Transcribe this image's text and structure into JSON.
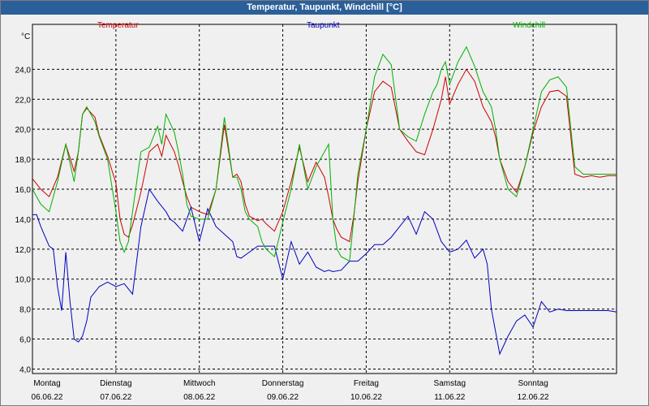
{
  "window": {
    "title": "Temperatur, Taupunkt, Windchill [°C]"
  },
  "chart_data": {
    "type": "line",
    "title": "Temperatur, Taupunkt, Windchill [°C]",
    "ylabel": "°C",
    "ylim": [
      3.7,
      27.0
    ],
    "yticks": [
      "4,0",
      "6,0",
      "8,0",
      "10,0",
      "12,0",
      "14,0",
      "16,0",
      "18,0",
      "20,0",
      "22,0",
      "24,0"
    ],
    "ytick_values": [
      4,
      6,
      8,
      10,
      12,
      14,
      16,
      18,
      20,
      22,
      24
    ],
    "xlim": [
      0,
      7
    ],
    "x_days": [
      {
        "day": "Montag",
        "date": "06.06.22"
      },
      {
        "day": "Dienstag",
        "date": "07.06.22"
      },
      {
        "day": "Mittwoch",
        "date": "08.06.22"
      },
      {
        "day": "Donnerstag",
        "date": "09.06.22"
      },
      {
        "day": "Freitag",
        "date": "10.06.22"
      },
      {
        "day": "Samstag",
        "date": "11.06.22"
      },
      {
        "day": "Sonntag",
        "date": "12.06.22"
      }
    ],
    "grid": true,
    "legend_position": "top",
    "series": [
      {
        "name": "Temperatur",
        "color": "#cc0000",
        "x": [
          0,
          0.1,
          0.2,
          0.3,
          0.4,
          0.5,
          0.55,
          0.6,
          0.65,
          0.75,
          0.8,
          0.9,
          1.0,
          1.05,
          1.1,
          1.15,
          1.2,
          1.3,
          1.4,
          1.5,
          1.55,
          1.6,
          1.7,
          1.75,
          1.8,
          1.85,
          1.9,
          2.0,
          2.1,
          2.2,
          2.3,
          2.4,
          2.45,
          2.5,
          2.55,
          2.6,
          2.7,
          2.75,
          2.8,
          2.9,
          3.0,
          3.1,
          3.2,
          3.3,
          3.4,
          3.5,
          3.55,
          3.6,
          3.65,
          3.7,
          3.8,
          3.85,
          3.9,
          4.0,
          4.1,
          4.2,
          4.3,
          4.4,
          4.5,
          4.6,
          4.7,
          4.8,
          4.85,
          4.9,
          4.95,
          5.0,
          5.1,
          5.2,
          5.3,
          5.4,
          5.45,
          5.5,
          5.55,
          5.6,
          5.7,
          5.8,
          5.9,
          6.0,
          6.1,
          6.2,
          6.3,
          6.4,
          6.5,
          6.6,
          6.7,
          6.8,
          6.9,
          6.95,
          7.0
        ],
        "values": [
          16.7,
          16.0,
          15.5,
          16.8,
          19.0,
          17.2,
          18.5,
          21.0,
          21.4,
          20.8,
          19.6,
          18.2,
          16.4,
          14.0,
          13.0,
          12.8,
          13.6,
          15.8,
          18.5,
          19.0,
          18.2,
          19.6,
          18.5,
          17.6,
          16.5,
          15.5,
          14.8,
          14.5,
          14.3,
          16.0,
          20.3,
          16.8,
          17.0,
          16.5,
          15.0,
          14.2,
          13.9,
          14.0,
          13.7,
          13.2,
          14.5,
          16.5,
          18.8,
          16.5,
          17.8,
          16.8,
          15.5,
          14.0,
          13.3,
          12.8,
          12.5,
          14.2,
          16.5,
          20.0,
          22.5,
          23.2,
          22.8,
          20.0,
          19.2,
          18.5,
          18.3,
          20.0,
          21.0,
          22.0,
          23.5,
          21.7,
          23.0,
          24.0,
          23.2,
          21.5,
          21.0,
          20.5,
          19.5,
          18.0,
          16.5,
          15.8,
          17.5,
          19.8,
          21.5,
          22.5,
          22.6,
          22.2,
          17.0,
          16.8,
          16.9,
          16.8,
          16.9,
          16.9,
          16.9
        ]
      },
      {
        "name": "Taupunkt",
        "color": "#0000c0",
        "x": [
          0,
          0.05,
          0.1,
          0.2,
          0.25,
          0.3,
          0.35,
          0.4,
          0.45,
          0.5,
          0.55,
          0.6,
          0.65,
          0.7,
          0.8,
          0.9,
          1.0,
          1.1,
          1.2,
          1.3,
          1.4,
          1.5,
          1.6,
          1.65,
          1.7,
          1.8,
          1.9,
          2.0,
          2.1,
          2.2,
          2.3,
          2.4,
          2.45,
          2.5,
          2.6,
          2.7,
          2.8,
          2.9,
          3.0,
          3.1,
          3.2,
          3.3,
          3.4,
          3.5,
          3.55,
          3.6,
          3.7,
          3.8,
          3.9,
          4.0,
          4.1,
          4.2,
          4.3,
          4.4,
          4.5,
          4.6,
          4.7,
          4.8,
          4.9,
          5.0,
          5.1,
          5.2,
          5.3,
          5.4,
          5.45,
          5.5,
          5.6,
          5.7,
          5.8,
          5.9,
          6.0,
          6.1,
          6.2,
          6.3,
          6.4,
          6.45,
          6.5,
          6.55,
          6.6,
          6.7,
          6.8,
          6.9,
          7.0
        ],
        "values": [
          14.3,
          14.3,
          13.5,
          12.2,
          12.0,
          9.5,
          7.9,
          11.8,
          8.5,
          6.0,
          5.8,
          6.2,
          7.2,
          8.8,
          9.5,
          9.8,
          9.5,
          9.7,
          9.0,
          13.5,
          16.0,
          15.2,
          14.5,
          14.0,
          13.8,
          13.2,
          14.8,
          12.5,
          14.7,
          13.5,
          13.0,
          12.5,
          11.5,
          11.4,
          11.8,
          12.2,
          12.2,
          12.2,
          10.0,
          12.5,
          11.0,
          11.8,
          10.8,
          10.5,
          10.6,
          10.5,
          10.6,
          11.2,
          11.2,
          11.7,
          12.3,
          12.3,
          12.8,
          13.5,
          14.2,
          13.0,
          14.5,
          14.0,
          12.5,
          11.8,
          12.0,
          12.6,
          11.4,
          12.0,
          11.0,
          8.0,
          5.0,
          6.2,
          7.2,
          7.6,
          6.8,
          8.5,
          7.8,
          8.0,
          7.9,
          7.9,
          7.9,
          7.9,
          7.9,
          7.9,
          7.9,
          7.9,
          7.8
        ]
      },
      {
        "name": "Windchill",
        "color": "#00b000",
        "x": [
          0,
          0.1,
          0.2,
          0.3,
          0.4,
          0.5,
          0.55,
          0.6,
          0.65,
          0.75,
          0.8,
          0.9,
          1.0,
          1.05,
          1.1,
          1.15,
          1.2,
          1.3,
          1.4,
          1.5,
          1.55,
          1.6,
          1.7,
          1.75,
          1.8,
          1.85,
          1.9,
          2.0,
          2.1,
          2.2,
          2.3,
          2.4,
          2.45,
          2.5,
          2.55,
          2.6,
          2.7,
          2.75,
          2.8,
          2.9,
          3.0,
          3.1,
          3.2,
          3.3,
          3.4,
          3.5,
          3.55,
          3.6,
          3.65,
          3.7,
          3.8,
          3.85,
          3.9,
          4.0,
          4.1,
          4.2,
          4.3,
          4.4,
          4.5,
          4.6,
          4.7,
          4.8,
          4.85,
          4.9,
          4.95,
          5.0,
          5.1,
          5.2,
          5.3,
          5.4,
          5.45,
          5.5,
          5.55,
          5.6,
          5.7,
          5.8,
          5.9,
          6.0,
          6.1,
          6.2,
          6.3,
          6.4,
          6.5,
          6.6,
          6.7,
          6.8,
          6.9,
          6.95,
          7.0
        ],
        "values": [
          16.0,
          15.0,
          14.5,
          16.5,
          19.0,
          16.5,
          18.5,
          21.0,
          21.5,
          20.5,
          19.5,
          18.0,
          14.5,
          12.5,
          11.8,
          12.5,
          14.5,
          18.5,
          18.8,
          20.2,
          19.0,
          21.0,
          19.8,
          18.5,
          17.0,
          15.0,
          14.2,
          14.0,
          14.0,
          16.0,
          20.8,
          16.8,
          16.8,
          16.0,
          14.5,
          14.0,
          13.5,
          12.5,
          12.0,
          11.5,
          13.8,
          16.0,
          19.0,
          16.0,
          17.5,
          18.5,
          19.0,
          14.0,
          12.0,
          11.5,
          11.2,
          14.0,
          17.0,
          20.0,
          23.5,
          25.0,
          24.3,
          20.0,
          19.5,
          19.2,
          21.0,
          22.5,
          23.0,
          24.0,
          24.5,
          23.0,
          24.5,
          25.5,
          24.2,
          22.5,
          22.0,
          21.5,
          20.0,
          18.0,
          16.0,
          15.5,
          17.5,
          20.0,
          22.5,
          23.3,
          23.5,
          22.8,
          17.5,
          17.0,
          17.0,
          17.0,
          17.0,
          17.0,
          17.0
        ]
      }
    ]
  }
}
